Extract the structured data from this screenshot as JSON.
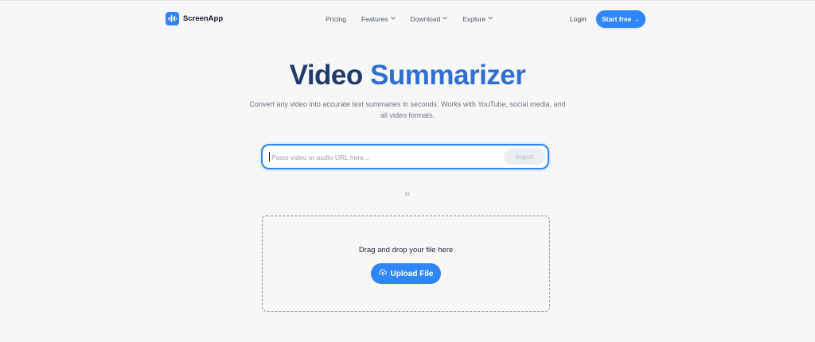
{
  "header": {
    "brand": "ScreenApp",
    "nav": [
      {
        "label": "Pricing",
        "dropdown": false
      },
      {
        "label": "Features",
        "dropdown": true
      },
      {
        "label": "Download",
        "dropdown": true
      },
      {
        "label": "Explore",
        "dropdown": true
      }
    ],
    "login_label": "Login",
    "start_label": "Start free",
    "start_arrow": "→"
  },
  "hero": {
    "title_word1": "Video",
    "title_word2": "Summarizer",
    "subtitle": "Convert any video into accurate text summaries in seconds. Works with YouTube, social media, and all video formats."
  },
  "url_input": {
    "value": "",
    "placeholder": "Paste video or audio URL here...",
    "import_label": "Import"
  },
  "divider_text": "or",
  "dropzone": {
    "prompt": "Drag and drop your file here",
    "upload_label": "Upload File"
  },
  "colors": {
    "accent": "#2f86f6",
    "title_dark": "#1f3b6b",
    "title_blue": "#2f6fd0"
  },
  "icons": [
    "soundwave-logo-icon",
    "chevron-down-icon",
    "arrow-right-icon",
    "cloud-upload-icon"
  ]
}
